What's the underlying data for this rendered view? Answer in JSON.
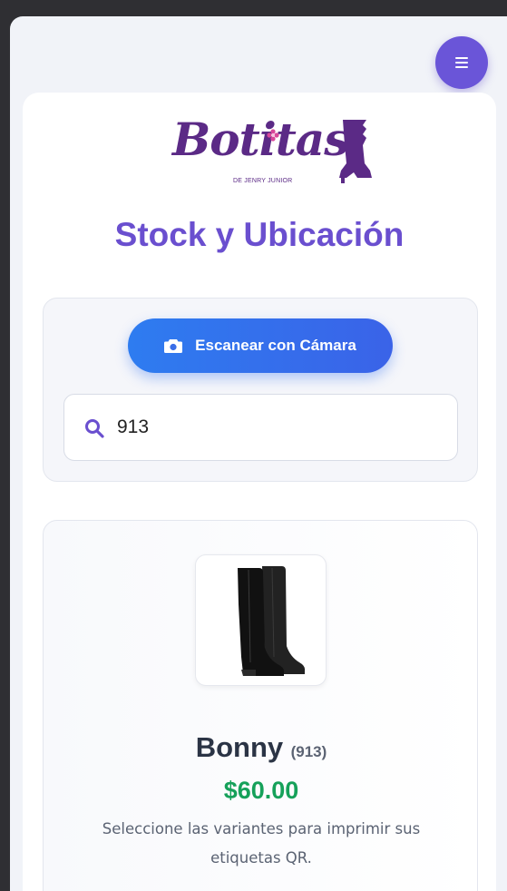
{
  "app": {
    "brand_name": "Botitas",
    "brand_tagline": "DE JENRY JUNIOR",
    "page_title": "Stock y Ubicación"
  },
  "toolbar": {
    "menu_icon": "menu-icon"
  },
  "scanner": {
    "scan_button_label": "Escanear con Cámara",
    "scan_icon": "camera-icon"
  },
  "search": {
    "value": "913",
    "icon": "search-icon"
  },
  "product": {
    "name": "Bonny",
    "code": "(913)",
    "price": "$60.00",
    "hint": "Seleccione las variantes para imprimir sus etiquetas QR."
  },
  "colors": {
    "accent": "#6a4fcf",
    "brand": "#5b2a86",
    "primary_button": "#2e7cf0",
    "price": "#16a15a"
  }
}
